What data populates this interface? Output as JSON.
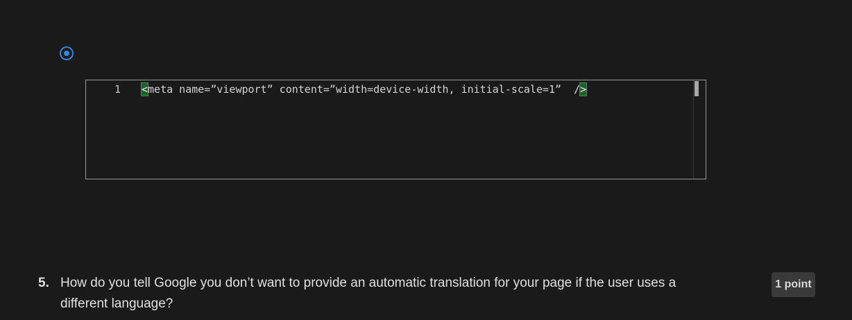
{
  "editor": {
    "line_number": "1",
    "code_open_bracket": "<",
    "code_body": "meta name=”viewport” content=”width=device-width, initial-scale=1”  /",
    "code_close_bracket": ">"
  },
  "question": {
    "number": "5.",
    "text": "How do you tell Google you don’t want to provide an automatic translation for your page if the user uses a different language?",
    "points": "1 point"
  },
  "colors": {
    "background": "#1a1a1a",
    "radio_accent": "#3b82d6",
    "bracket_highlight": "#2f9e44"
  }
}
